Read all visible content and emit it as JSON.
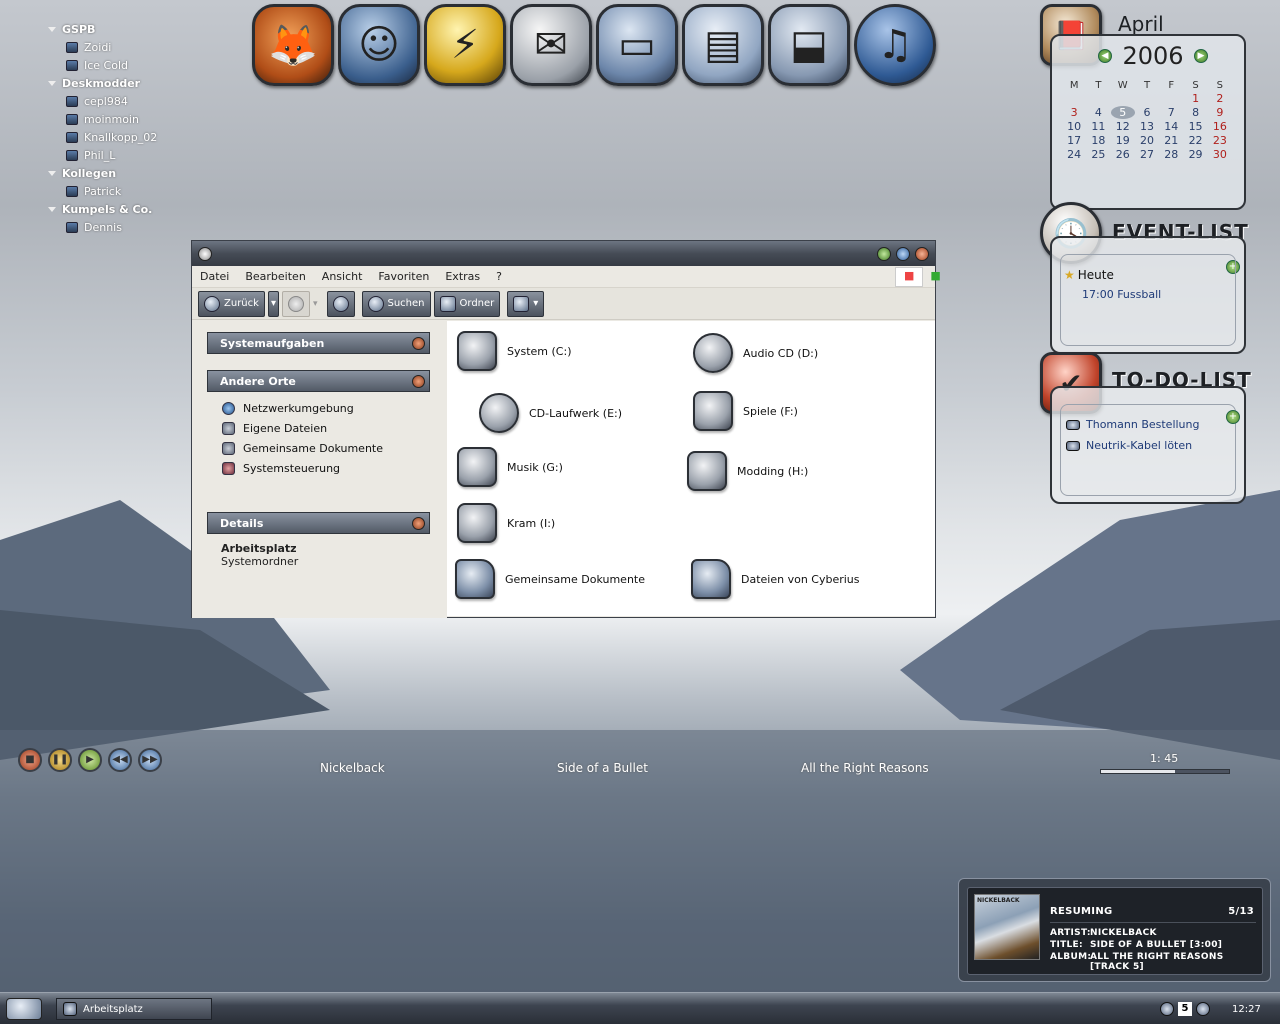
{
  "contacts": {
    "groups": [
      {
        "name": "GSPB",
        "members": [
          "Zoidi",
          "Ice Cold"
        ]
      },
      {
        "name": "Deskmodder",
        "members": [
          "cepl984",
          "moinmoin",
          "Knallkopp_02",
          "Phil_L"
        ]
      },
      {
        "name": "Kollegen",
        "members": [
          "Patrick"
        ]
      },
      {
        "name": "Kumpels & Co.",
        "members": [
          "Dennis"
        ]
      }
    ]
  },
  "dock": {
    "icons": [
      "firefox-icon",
      "messenger-icon",
      "winamp-icon",
      "mail-icon",
      "computer-icon",
      "folder-icon",
      "outbox-icon",
      "music-globe-icon"
    ]
  },
  "calendar": {
    "month": "April",
    "year": "2006",
    "days": [
      "M",
      "T",
      "W",
      "T",
      "F",
      "S",
      "S"
    ],
    "weeks": [
      [
        "",
        "",
        "",
        "",
        "",
        "1",
        "2"
      ],
      [
        "3",
        "4",
        "5",
        "6",
        "7",
        "8",
        "9"
      ],
      [
        "10",
        "11",
        "12",
        "13",
        "14",
        "15",
        "16"
      ],
      [
        "17",
        "18",
        "19",
        "20",
        "21",
        "22",
        "23"
      ],
      [
        "24",
        "25",
        "26",
        "27",
        "28",
        "29",
        "30"
      ]
    ],
    "today": "5"
  },
  "events": {
    "title": "EVENT-LIST",
    "heading": "Heute",
    "item": "17:00 Fussball"
  },
  "todo": {
    "title": "TO-DO-LIST",
    "items": [
      "Thomann Bestellung",
      "Neutrik-Kabel löten"
    ]
  },
  "window": {
    "menu": [
      "Datei",
      "Bearbeiten",
      "Ansicht",
      "Favoriten",
      "Extras",
      "?"
    ],
    "toolbar": {
      "back": "Zurück",
      "search": "Suchen",
      "folders": "Ordner"
    },
    "sections": {
      "tasks": "Systemaufgaben",
      "places": "Andere Orte",
      "details": "Details"
    },
    "places": [
      "Netzwerkumgebung",
      "Eigene Dateien",
      "Gemeinsame Dokumente",
      "Systemsteuerung"
    ],
    "details": {
      "name": "Arbeitsplatz",
      "type": "Systemordner"
    },
    "drives": [
      "System (C:)",
      "Audio CD (D:)",
      "CD-Laufwerk (E:)",
      "Spiele (F:)",
      "Musik (G:)",
      "Modding (H:)",
      "Kram (I:)",
      "Gemeinsame Dokumente",
      "Dateien von Cyberius"
    ]
  },
  "player": {
    "artist": "Nickelback",
    "title": "Side of a Bullet",
    "album": "All the Right Reasons",
    "time": "1: 45",
    "progress": 0.58
  },
  "nowplaying": {
    "status": "RESUMING",
    "track_count": "5/13",
    "artist_label": "ARTIST:",
    "artist": "NICKELBACK",
    "title_label": "TITLE:",
    "title": "SIDE OF A BULLET [3:00]",
    "album_label": "ALBUM:",
    "album": "ALL THE RIGHT REASONS [TRACK 5]",
    "cover_text": "NICKELBACK"
  },
  "taskbar": {
    "task": "Arbeitsplatz",
    "clock": "12:27",
    "tray_num": "5"
  }
}
